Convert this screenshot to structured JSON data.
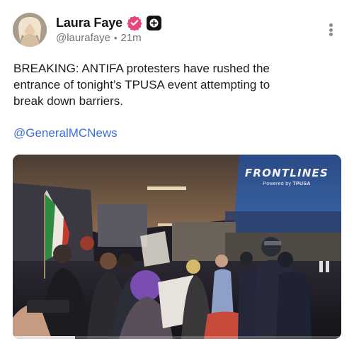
{
  "post": {
    "author": {
      "display_name": "Laura Faye",
      "handle": "@laurafaye",
      "separator": "•",
      "time": "21m",
      "verified": true
    },
    "text": "BREAKING: ANTIFA protesters have rushed the\nentrance of tonight’s TPUSA event attempting to\nbreak down barriers.",
    "mention": "@GeneralMCNews",
    "media": {
      "watermark_title": "FRONTLINES",
      "watermark_powered": "Powered by",
      "watermark_brand": "TPUSA",
      "playback_progress": 0.19
    }
  },
  "icons": {
    "verified": "verified-badge-icon",
    "plus": "plus-badge-icon",
    "more": "more-vertical-icon",
    "pause": "pause-icon"
  },
  "colors": {
    "verified": "#e8467b",
    "mention": "#3b6fd8",
    "secondary_text": "#6e7378"
  }
}
